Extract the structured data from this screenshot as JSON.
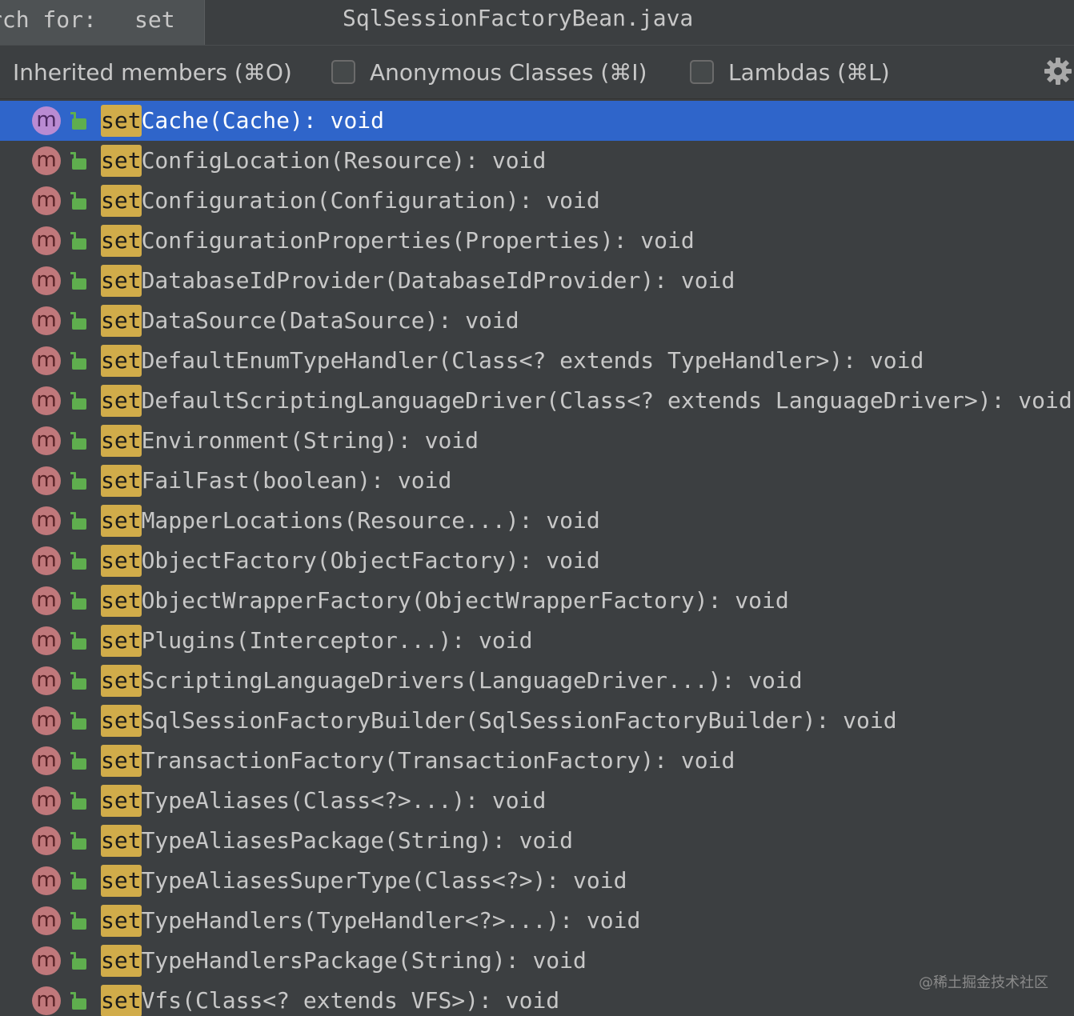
{
  "search": {
    "label": "rch for:",
    "query": "set"
  },
  "window": {
    "file_title": "SqlSessionFactoryBean.java"
  },
  "toolbar": {
    "inherited_members": "Inherited members (⌘O)",
    "anonymous_classes": "Anonymous Classes (⌘I)",
    "lambdas": "Lambdas (⌘L)",
    "anonymous_classes_checked": false,
    "lambdas_checked": false,
    "settings_icon": "gear-icon"
  },
  "colors": {
    "selection": "#2f65ca",
    "match_highlight": "#d1ac4a",
    "method_icon": "#c0787b",
    "selected_method_icon": "#b98bd2",
    "public_lock": "#5fae4e"
  },
  "members": {
    "icon": "m",
    "match": "set",
    "selected_index": 0,
    "items": [
      {
        "rest": "Cache(Cache): void"
      },
      {
        "rest": "ConfigLocation(Resource): void"
      },
      {
        "rest": "Configuration(Configuration): void"
      },
      {
        "rest": "ConfigurationProperties(Properties): void"
      },
      {
        "rest": "DatabaseIdProvider(DatabaseIdProvider): void"
      },
      {
        "rest": "DataSource(DataSource): void"
      },
      {
        "rest": "DefaultEnumTypeHandler(Class<? extends TypeHandler>): void"
      },
      {
        "rest": "DefaultScriptingLanguageDriver(Class<? extends LanguageDriver>): void"
      },
      {
        "rest": "Environment(String): void"
      },
      {
        "rest": "FailFast(boolean): void"
      },
      {
        "rest": "MapperLocations(Resource...): void"
      },
      {
        "rest": "ObjectFactory(ObjectFactory): void"
      },
      {
        "rest": "ObjectWrapperFactory(ObjectWrapperFactory): void"
      },
      {
        "rest": "Plugins(Interceptor...): void"
      },
      {
        "rest": "ScriptingLanguageDrivers(LanguageDriver...): void"
      },
      {
        "rest": "SqlSessionFactoryBuilder(SqlSessionFactoryBuilder): void"
      },
      {
        "rest": "TransactionFactory(TransactionFactory): void"
      },
      {
        "rest": "TypeAliases(Class<?>...): void"
      },
      {
        "rest": "TypeAliasesPackage(String): void"
      },
      {
        "rest": "TypeAliasesSuperType(Class<?>): void"
      },
      {
        "rest": "TypeHandlers(TypeHandler<?>...): void"
      },
      {
        "rest": "TypeHandlersPackage(String): void"
      },
      {
        "rest": "Vfs(Class<? extends VFS>): void"
      }
    ]
  },
  "watermark": "@稀土掘金技术社区"
}
